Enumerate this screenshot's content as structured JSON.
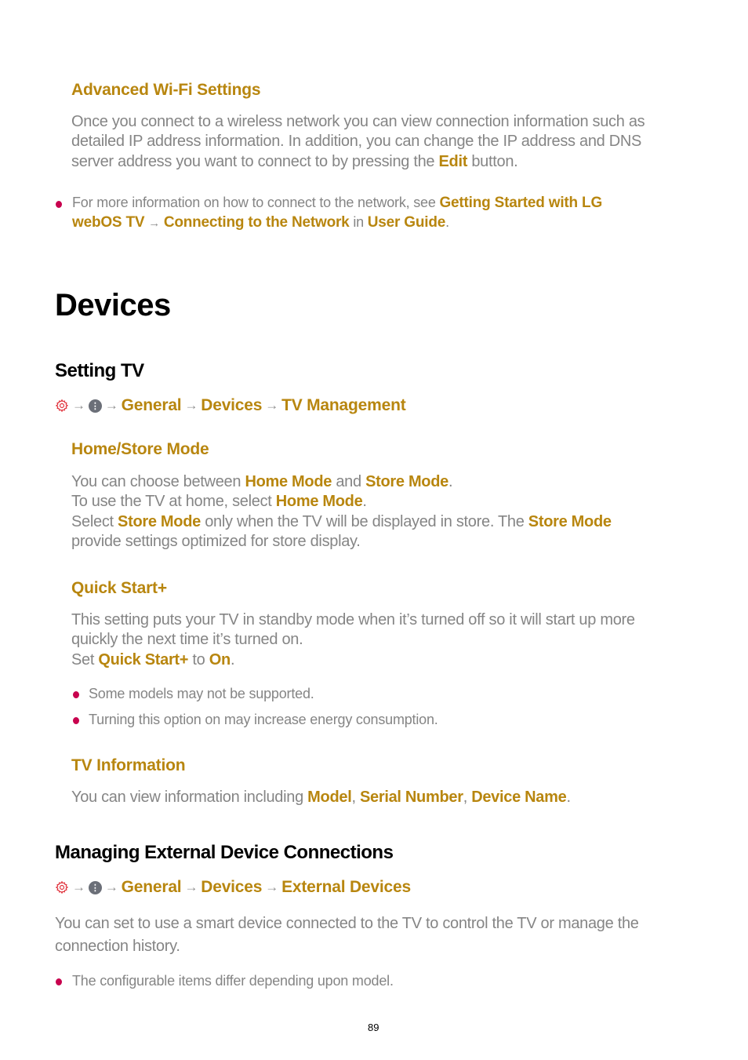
{
  "advanced_wifi": {
    "heading": "Advanced Wi-Fi Settings",
    "para_1": "Once you connect to a wireless network you can view connection information such as",
    "para_2": "detailed IP address information. In addition, you can change the IP address and DNS",
    "para_3_pre": "server address you want to connect to by pressing the ",
    "para_3_link": "Edit",
    "para_3_post": " button.",
    "note": {
      "pre": "For more information on how to connect to the network, see ",
      "link_1a": "Getting Started with LG",
      "link_1b": "webOS TV",
      "arrow": "→",
      "link_2": "Connecting to the Network",
      "mid": " in ",
      "link_3": "User Guide",
      "post": "."
    }
  },
  "devices": {
    "title": "Devices",
    "setting_tv": {
      "heading": "Setting TV",
      "path": {
        "icons": [
          "gear-icon",
          "more-icon"
        ],
        "arrow": "→",
        "steps": [
          "General",
          "Devices",
          "TV Management"
        ]
      },
      "home_store": {
        "heading": "Home/Store Mode",
        "l1_pre": "You can choose between ",
        "l1_b1": "Home Mode",
        "l1_mid": " and ",
        "l1_b2": "Store Mode",
        "l1_post": ".",
        "l2_pre": "To use the TV at home, select ",
        "l2_b": "Home Mode",
        "l2_post": ".",
        "l3_pre": "Select ",
        "l3_b1": "Store Mode",
        "l3_mid": " only when the TV will be displayed in store. The ",
        "l3_b2": "Store Mode",
        "l4": "provide settings optimized for store display."
      },
      "quick_start": {
        "heading": "Quick Start+",
        "l1": "This setting puts your TV in standby mode when it’s turned off so it will start up more",
        "l2": "quickly the next time it’s turned on.",
        "l3_pre": "Set ",
        "l3_b1": "Quick Start+",
        "l3_mid": " to ",
        "l3_b2": "On",
        "l3_post": ".",
        "notes": [
          "Some models may not be supported.",
          "Turning this option on may increase energy consumption."
        ]
      },
      "tv_info": {
        "heading": "TV Information",
        "pre": "You can view information including ",
        "b1": "Model",
        "sep1": ", ",
        "b2": "Serial Number",
        "sep2": ", ",
        "b3": "Device Name",
        "post": "."
      }
    },
    "external": {
      "heading": "Managing External Device Connections",
      "path": {
        "arrow": "→",
        "steps": [
          "General",
          "Devices",
          "External Devices"
        ]
      },
      "l1": "You can set to use a smart device connected to the TV to control the TV or manage the",
      "l2": "connection history.",
      "note": "The configurable items differ depending upon model."
    }
  },
  "footer": {
    "page_number": "89"
  }
}
